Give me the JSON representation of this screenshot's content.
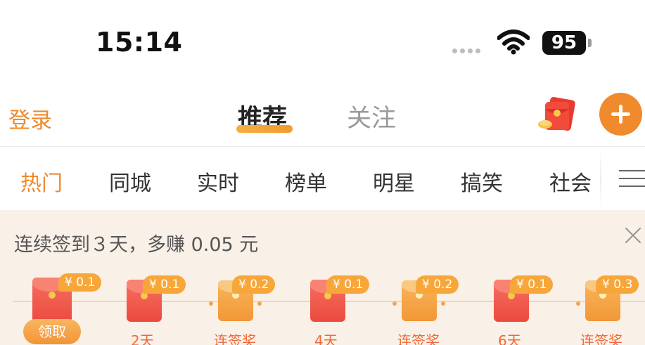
{
  "status_bar": {
    "time": "15:14",
    "battery": "95"
  },
  "top_nav": {
    "login": "登录",
    "tabs": [
      {
        "label": "推荐",
        "active": true
      },
      {
        "label": "关注",
        "active": false
      }
    ],
    "icons": [
      "red-packet-icon",
      "plus-icon"
    ],
    "accent_color": "#EE8A2E"
  },
  "channels": {
    "items": [
      "热门",
      "同城",
      "实时",
      "榜单",
      "明星",
      "搞笑",
      "社会"
    ],
    "active_index": 0
  },
  "signin": {
    "title": "连续签到３天，多赚 0.05 元",
    "claim_label": "领取",
    "days": [
      {
        "reward": "¥ 0.1",
        "label": "",
        "type": "red",
        "claimable": true
      },
      {
        "reward": "¥ 0.1",
        "label": "2天",
        "type": "red",
        "claimable": false
      },
      {
        "reward": "¥ 0.2",
        "label": "连签奖",
        "type": "gold",
        "claimable": false
      },
      {
        "reward": "¥ 0.1",
        "label": "4天",
        "type": "red",
        "claimable": false
      },
      {
        "reward": "¥ 0.2",
        "label": "连签奖",
        "type": "gold",
        "claimable": false
      },
      {
        "reward": "¥ 0.1",
        "label": "6天",
        "type": "red",
        "claimable": false
      },
      {
        "reward": "¥ 0.3",
        "label": "连签奖",
        "type": "gold",
        "claimable": false
      }
    ]
  }
}
